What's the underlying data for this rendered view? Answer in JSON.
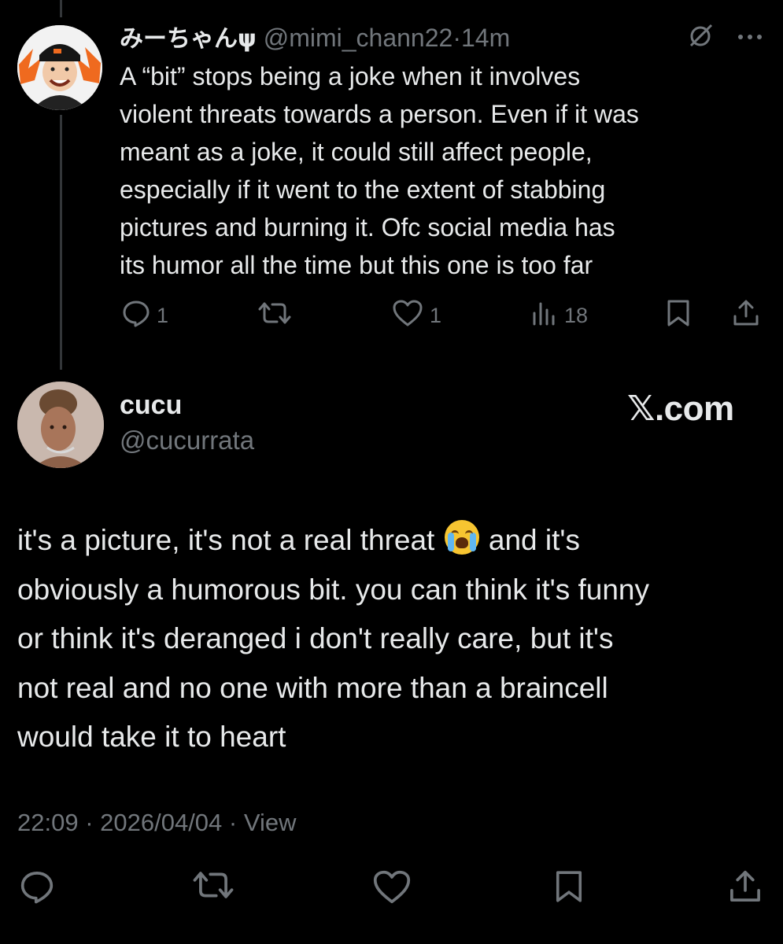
{
  "reply": {
    "display_name": "みーちゃんψ",
    "handle": "@mimi_chann22",
    "separator": "·",
    "time": "14m",
    "text": "A “bit” stops being a joke when it involves\nviolent threats towards a person. Even if it was\nmeant as a joke, it could still affect people,\nespecially if it went to the extent of stabbing\npictures and burning it. Ofc social media has\nits humor all the time but this one is too far",
    "replies": "1",
    "likes": "1",
    "views": "18"
  },
  "post": {
    "display_name": "cucu",
    "handle": "@cucurrata",
    "brand": "𝕏.com",
    "text_part1": "it's a picture, it's not a real threat ",
    "text_part2": " and it's\nobviously a humorous bit. you can think it's funny\nor think it's deranged i don't really care, but it's\nnot real and no one with more than a braincell\nwould take it to heart",
    "time": "22:09",
    "date": "2026/04/04",
    "view_label": "View",
    "sep": " · "
  },
  "colors": {
    "background": "#000000",
    "text": "#e7e9ea",
    "muted": "#71767b"
  },
  "icons": [
    "reply-icon",
    "repost-icon",
    "like-icon",
    "views-icon",
    "bookmark-icon",
    "share-icon",
    "grok-icon",
    "more-icon"
  ]
}
